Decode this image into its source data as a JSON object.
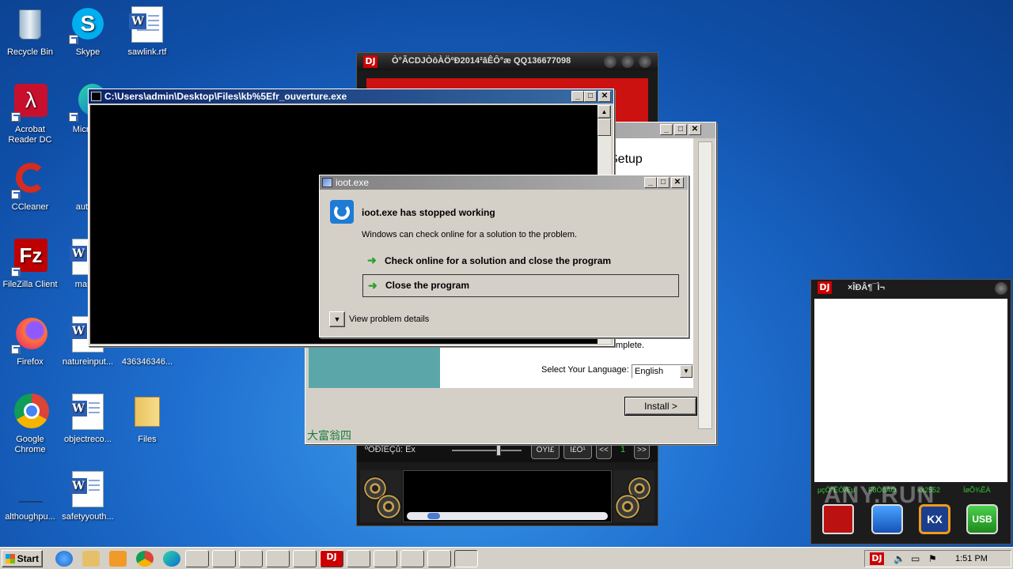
{
  "desktop": {
    "icons": [
      {
        "label": "Recycle Bin"
      },
      {
        "label": "Skype"
      },
      {
        "label": "sawlink.rtf"
      },
      {
        "label": "Acrobat Reader DC"
      },
      {
        "label": "Microso"
      },
      {
        "label": "CCleaner"
      },
      {
        "label": "autom"
      },
      {
        "label": "FileZilla Client"
      },
      {
        "label": "mapsc"
      },
      {
        "label": "Firefox"
      },
      {
        "label": "natureinput..."
      },
      {
        "label": "436346346..."
      },
      {
        "label": "Google Chrome"
      },
      {
        "label": "objectreco..."
      },
      {
        "label": "Files"
      },
      {
        "label": "althoughpu..."
      },
      {
        "label": "safetyyouth..."
      }
    ]
  },
  "dj_player": {
    "title": "Ò°ÃCDJÒôÀÖºÐ2014²âÊÔ°æ QQ136677098",
    "status_label": "ºÓÐîÈÇû: Êx",
    "btn1": "ÕÝÍ£",
    "btn2": "Í£Ö¹",
    "prev": "<<",
    "track": "1",
    "next": ">>",
    "bottom_chinese": "大富翁四"
  },
  "setup": {
    "heading": "Setup",
    "complete_text": "mplete.",
    "lang_label": "Select Your Language:",
    "lang_value": "English",
    "install": "Install >"
  },
  "console": {
    "title": "C:\\Users\\admin\\Desktop\\Files\\kb%5Efr_ouverture.exe"
  },
  "error_dialog": {
    "title": "ioot.exe",
    "heading": "ioot.exe has stopped working",
    "message": "Windows can check online for a solution to the problem.",
    "option1": "Check online for a solution and close the program",
    "option2": "Close the program",
    "details": "View problem details"
  },
  "side_panel": {
    "title": "×ÎÐÂ¶¯Ì¬",
    "footer_items": [
      "µçÓ°ÊÓÆµ",
      "F8ÒôÀÖ",
      "kx2552",
      "ÍøÕ¾ÊÀ"
    ],
    "watermark": "ANY.RUN",
    "usb_label": "USB"
  },
  "taskbar": {
    "start": "Start",
    "time": "1:51 PM"
  },
  "colors": {
    "desktop": "#1f6fd0",
    "title_active": "#0a246a",
    "dialog_bg": "#d4d0c8",
    "dj_red": "#cc0000"
  }
}
